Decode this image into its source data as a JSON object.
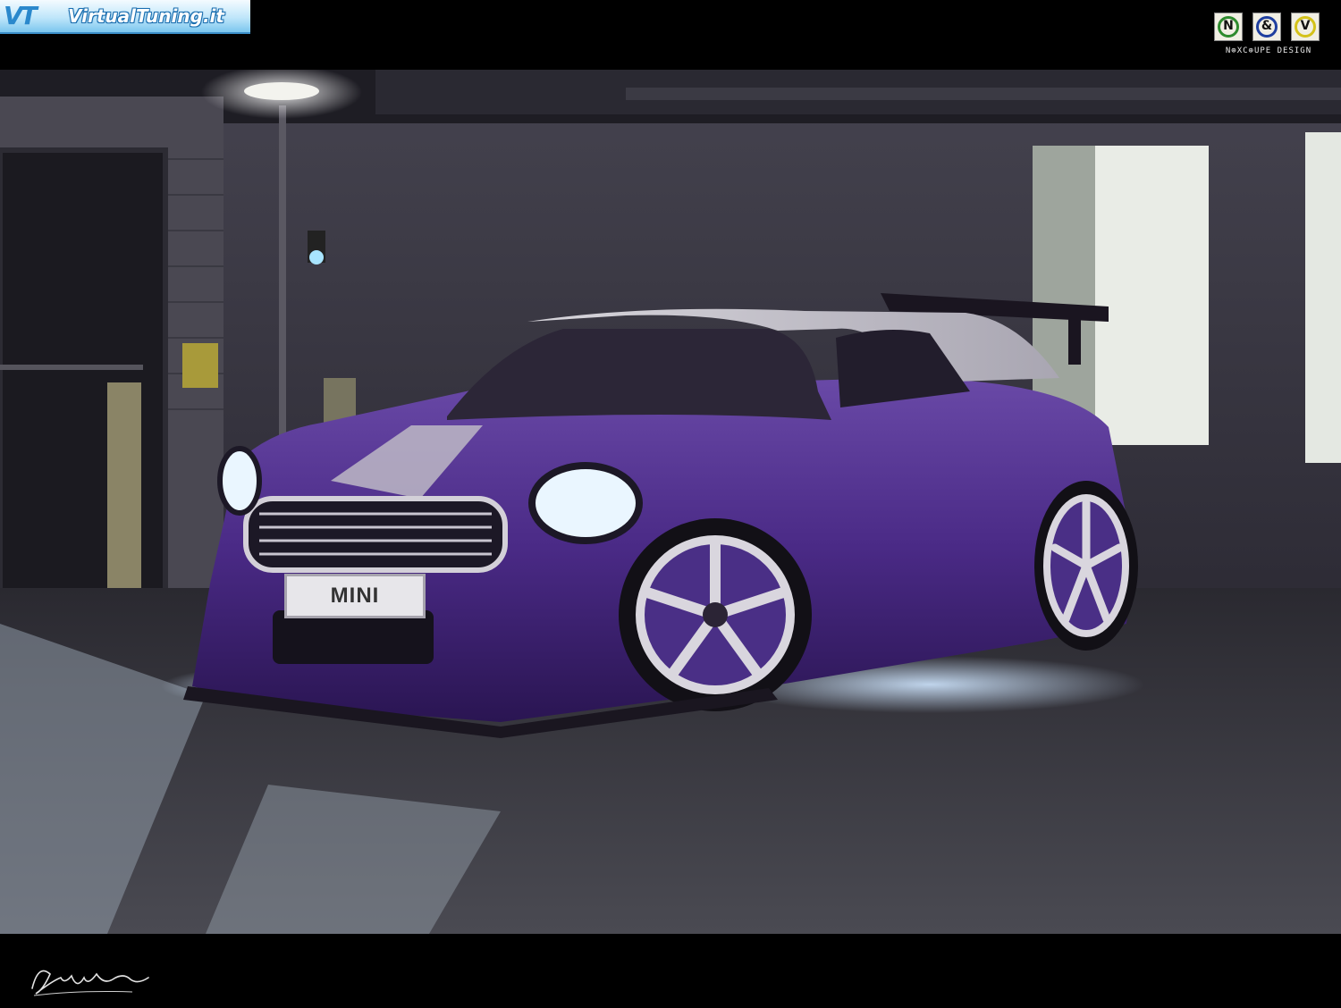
{
  "watermark": {
    "site_name": "VirtualTuning.it",
    "logo_mark": "VT"
  },
  "designer": {
    "badges": [
      "N",
      "&",
      "V"
    ],
    "name": "N⊕XC⊕UPE DESIGN"
  },
  "car": {
    "plate_text": "MINI"
  },
  "colors": {
    "body": "#4a2a86",
    "background_wall": "#3a3846",
    "frame": "#000000"
  },
  "icons": {
    "signature": "signature-icon"
  }
}
